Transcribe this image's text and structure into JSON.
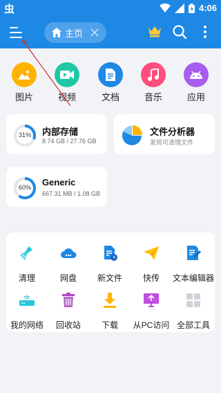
{
  "status_bar": {
    "app_glyph": "虫",
    "time": "4:06"
  },
  "app_bar": {
    "tab_label": "主页"
  },
  "quick_access": [
    {
      "label": "图片",
      "icon": "image-icon",
      "color": "#ffb300"
    },
    {
      "label": "视频",
      "icon": "video-icon",
      "color": "#1ec7a6"
    },
    {
      "label": "文档",
      "icon": "document-icon",
      "color": "#1e88e5"
    },
    {
      "label": "音乐",
      "icon": "music-icon",
      "color": "#ff4d7d"
    },
    {
      "label": "应用",
      "icon": "android-icon",
      "color": "#a85cf0"
    }
  ],
  "internal_storage": {
    "title": "内部存储",
    "percent": "31%",
    "size": "8.74 GB / 27.76 GB",
    "fill_fraction": 0.31
  },
  "file_analyzer": {
    "title": "文件分析器",
    "subtitle": "发现可清理文件"
  },
  "generic_storage": {
    "title": "Generic",
    "percent": "60%",
    "size": "667.31 MB / 1.08 GB",
    "fill_fraction": 0.6
  },
  "tools": [
    {
      "label": "清理",
      "icon": "broom-icon"
    },
    {
      "label": "网盘",
      "icon": "cloud-icon"
    },
    {
      "label": "新文件",
      "icon": "new-file-icon"
    },
    {
      "label": "快传",
      "icon": "send-icon"
    },
    {
      "label": "文本编辑器",
      "icon": "text-editor-icon"
    },
    {
      "label": "我的网络",
      "icon": "router-icon"
    },
    {
      "label": "回收站",
      "icon": "recycle-bin-icon"
    },
    {
      "label": "下载",
      "icon": "download-icon"
    },
    {
      "label": "从PC访问",
      "icon": "pc-access-icon"
    },
    {
      "label": "全部工具",
      "icon": "all-tools-icon"
    }
  ],
  "colors": {
    "primary": "#1e88e5",
    "background": "#f1f3f6",
    "annotation_arrow": "#d32f2f"
  }
}
